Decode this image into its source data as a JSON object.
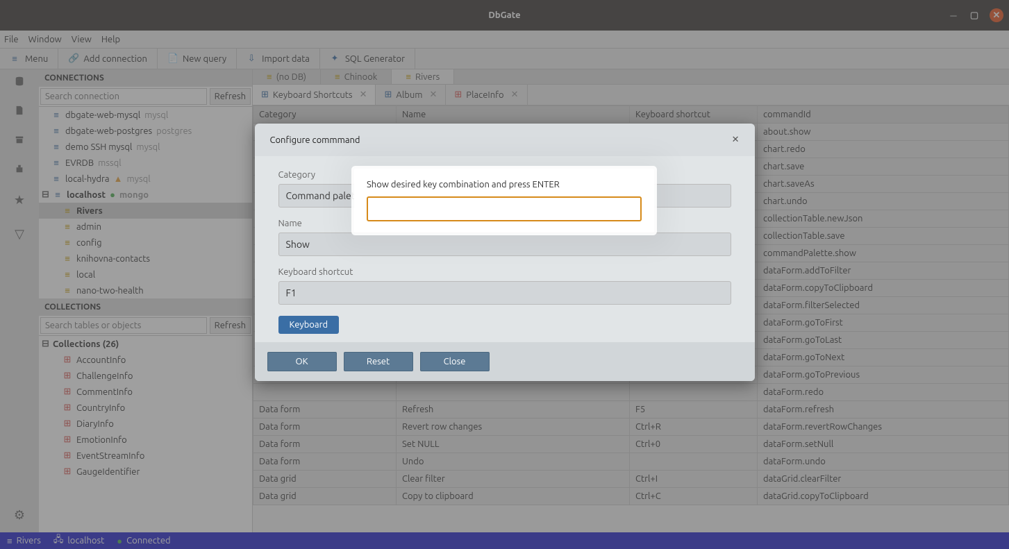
{
  "title": "DbGate",
  "menubar": [
    "File",
    "Window",
    "View",
    "Help"
  ],
  "toolbar": [
    {
      "label": "Menu",
      "icon": "menu-icon"
    },
    {
      "label": "Add connection",
      "icon": "link-icon"
    },
    {
      "label": "New query",
      "icon": "file-icon"
    },
    {
      "label": "Import data",
      "icon": "import-icon"
    },
    {
      "label": "SQL Generator",
      "icon": "sql-icon"
    }
  ],
  "sidebar": {
    "connections_header": "CONNECTIONS",
    "search_conn_placeholder": "Search connection",
    "refresh_label": "Refresh",
    "connections": [
      {
        "name": "dbgate-web-mysql",
        "engine": "mysql"
      },
      {
        "name": "dbgate-web-postgres",
        "engine": "postgres"
      },
      {
        "name": "demo SSH mysql",
        "engine": "mysql"
      },
      {
        "name": "EVRDB",
        "engine": "mssql"
      },
      {
        "name": "local-hydra",
        "engine": "mysql",
        "warn": true
      },
      {
        "name": "localhost",
        "engine": "mongo",
        "ok": true,
        "bold": true,
        "expanded": true
      }
    ],
    "databases": [
      {
        "name": "Rivers",
        "bold": true,
        "selected": true
      },
      {
        "name": "admin"
      },
      {
        "name": "config"
      },
      {
        "name": "knihovna-contacts"
      },
      {
        "name": "local"
      },
      {
        "name": "nano-two-health"
      }
    ],
    "collections_header": "COLLECTIONS",
    "search_obj_placeholder": "Search tables or objects",
    "collections_group": "Collections (26)",
    "collections": [
      "AccountInfo",
      "ChallengeInfo",
      "CommentInfo",
      "CountryInfo",
      "DiaryInfo",
      "EmotionInfo",
      "EventStreamInfo",
      "GaugeIdentifier"
    ]
  },
  "db_tabs": [
    {
      "label": "(no DB)"
    },
    {
      "label": "Chinook"
    },
    {
      "label": "Rivers",
      "active": true
    }
  ],
  "page_tabs": [
    {
      "label": "Keyboard Shortcuts",
      "icon": "window-icon",
      "active": true
    },
    {
      "label": "Album",
      "icon": "table-blue-icon"
    },
    {
      "label": "PlaceInfo",
      "icon": "table-red-icon"
    }
  ],
  "table": {
    "headers": [
      "Category",
      "Name",
      "Keyboard shortcut",
      "commandId"
    ],
    "rows": [
      [
        "",
        "",
        "",
        "about.show"
      ],
      [
        "",
        "",
        "",
        "chart.redo"
      ],
      [
        "",
        "",
        "",
        "chart.save"
      ],
      [
        "",
        "",
        "",
        "chart.saveAs"
      ],
      [
        "",
        "",
        "",
        "chart.undo"
      ],
      [
        "",
        "",
        "",
        "collectionTable.newJson"
      ],
      [
        "",
        "",
        "",
        "collectionTable.save"
      ],
      [
        "",
        "",
        "",
        "commandPalette.show"
      ],
      [
        "",
        "",
        "",
        "dataForm.addToFilter"
      ],
      [
        "",
        "",
        "",
        "dataForm.copyToClipboard"
      ],
      [
        "",
        "",
        "",
        "dataForm.filterSelected"
      ],
      [
        "",
        "",
        "",
        "dataForm.goToFirst"
      ],
      [
        "",
        "",
        "",
        "dataForm.goToLast"
      ],
      [
        "",
        "",
        "",
        "dataForm.goToNext"
      ],
      [
        "",
        "",
        "",
        "dataForm.goToPrevious"
      ],
      [
        "",
        "",
        "",
        "dataForm.redo"
      ],
      [
        "Data form",
        "Refresh",
        "F5",
        "dataForm.refresh"
      ],
      [
        "Data form",
        "Revert row changes",
        "Ctrl+R",
        "dataForm.revertRowChanges"
      ],
      [
        "Data form",
        "Set NULL",
        "Ctrl+0",
        "dataForm.setNull"
      ],
      [
        "Data form",
        "Undo",
        "",
        "dataForm.undo"
      ],
      [
        "Data grid",
        "Clear filter",
        "Ctrl+I",
        "dataGrid.clearFilter"
      ],
      [
        "Data grid",
        "Copy to clipboard",
        "Ctrl+C",
        "dataGrid.copyToClipboard"
      ]
    ]
  },
  "modal": {
    "title": "Configure commmand",
    "category_label": "Category",
    "category_value": "Command palet",
    "name_label": "Name",
    "name_value": "Show",
    "shortcut_label": "Keyboard shortcut",
    "shortcut_value": "F1",
    "keyboard_btn": "Keyboard",
    "ok": "OK",
    "reset": "Reset",
    "close": "Close"
  },
  "popover": {
    "hint": "Show desired key combination and press ENTER",
    "value": ""
  },
  "statusbar": {
    "db": "Rivers",
    "host": "localhost",
    "status": "Connected"
  }
}
